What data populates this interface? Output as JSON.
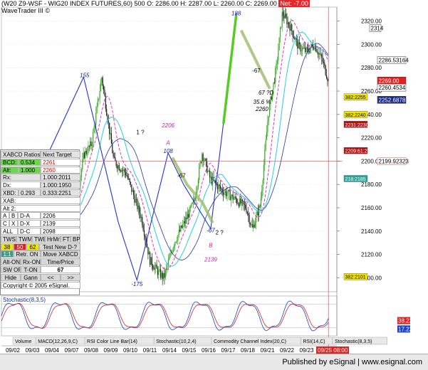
{
  "header": {
    "line1_prefix": "(W20 Z9-WSF - WIG20 INDEX FUTURES,60) 500",
    "o": "O: 2286.00",
    "h": "H: 2287.00",
    "l": "L: 2260.00",
    "c": "C: 2269.00",
    "net": "Net: -7.00",
    "line2": "WaveTrader III ©"
  },
  "colors": {
    "up_candle": "#33aa22",
    "down_candle": "#222222",
    "wave_line": "#2233cc",
    "green_channel": "#99bb66",
    "cyan_ma": "#22ccee",
    "blue_ma": "#2233aa",
    "magenta_ma": "#dd22aa",
    "stoch_blue": "#1144cc",
    "stoch_red": "#dd2222",
    "crosshair": "#e05050"
  },
  "chart_data": [
    {
      "type": "candlestick",
      "interval": "60 min",
      "yaxis_ticks": [
        2100,
        2120,
        2140,
        2160,
        2180,
        2200,
        2220,
        2240,
        2260,
        2280,
        2300,
        2320
      ],
      "ylim": [
        2088,
        2332
      ],
      "x_ticks": [
        "09/02",
        "09/03",
        "09/04",
        "09/07",
        "09/08",
        "09/09",
        "09/10",
        "09/11",
        "09/14",
        "09/15",
        "09/16",
        "09/17",
        "09/18",
        "09/21",
        "09/22",
        "09/23",
        "0"
      ],
      "current_time_label": "09/25 08:00",
      "price_labels": [
        {
          "text": "2314",
          "value": 2314,
          "style": "white"
        },
        {
          "text": "2286.53164",
          "value": 2286.5,
          "style": "white-magenta"
        },
        {
          "text": "2269.00",
          "value": 2269,
          "style": "red"
        },
        {
          "text": "2260.4534",
          "value": 2263,
          "style": "white-green"
        },
        {
          "text": "2252.6878",
          "value": 2252.5,
          "style": "navy"
        },
        {
          "text": "2199.92323",
          "value": 2199.9,
          "style": "red-line"
        }
      ],
      "level_boxes": [
        {
          "text": "382:2255",
          "value": 2255,
          "style": "yellow"
        },
        {
          "text": "382:2240",
          "value": 2240,
          "style": "yellow"
        },
        {
          "text": "2231:2230",
          "value": 2231.5,
          "style": "darkred"
        },
        {
          "text": "2209:61:2208",
          "value": 2209,
          "style": "darkred"
        },
        {
          "text": "218:2185",
          "value": 2185,
          "style": "teal"
        },
        {
          "text": "382:2101",
          "value": 2101,
          "style": "yellow"
        }
      ],
      "annotations": [
        {
          "text": "155",
          "x": 0.248,
          "value": 2272,
          "color": "#1122aa",
          "italic": true
        },
        {
          "text": "1 ?",
          "x": 0.414,
          "value": 2223,
          "color": "#000000",
          "italic": false
        },
        {
          "text": "2206",
          "x": 0.497,
          "value": 2229,
          "color": "#cc22aa",
          "italic": true
        },
        {
          "text": "A",
          "x": 0.497,
          "value": 2214,
          "color": "#cc22aa",
          "italic": true
        },
        {
          "text": "108",
          "x": 0.497,
          "value": 2207,
          "color": "#1122aa",
          "italic": true
        },
        {
          "text": "-67",
          "x": 0.537,
          "value": 2186,
          "color": "#000000",
          "italic": false
        },
        {
          "text": "-175",
          "x": 0.404,
          "value": 2093,
          "color": "#1122aa",
          "italic": true
        },
        {
          "text": "-67",
          "x": 0.624,
          "value": 2139,
          "color": "#1122aa",
          "italic": true
        },
        {
          "text": "2 ?",
          "x": 0.65,
          "value": 2137,
          "color": "#000000",
          "italic": false
        },
        {
          "text": "B",
          "x": 0.624,
          "value": 2126,
          "color": "#cc22aa",
          "italic": true
        },
        {
          "text": "2139",
          "x": 0.624,
          "value": 2114,
          "color": "#cc22aa",
          "italic": true
        },
        {
          "text": "188",
          "x": 0.7,
          "value": 2325,
          "color": "#1122aa",
          "italic": true
        },
        {
          "text": "-67",
          "x": 0.76,
          "value": 2276,
          "color": "#000000",
          "italic": false
        },
        {
          "text": "67 ?D",
          "x": 0.789,
          "value": 2257,
          "color": "#000000",
          "italic": true
        },
        {
          "text": "35.6 %",
          "x": 0.777,
          "value": 2249,
          "color": "#000000",
          "italic": true
        },
        {
          "text": "2260",
          "x": 0.777,
          "value": 2243,
          "color": "#000000",
          "italic": true
        }
      ]
    },
    {
      "type": "line",
      "title": "Stochastic(8,3,5)",
      "ylim": [
        0,
        100
      ],
      "reference_lines": [
        20,
        80
      ],
      "value_labels": [
        {
          "text": "38.22",
          "value": 38.22,
          "style": "red"
        },
        {
          "text": "17.22",
          "value": 17.22,
          "style": "blue"
        }
      ]
    }
  ],
  "tabs": [
    {
      "label": "Volume"
    },
    {
      "label": "MACD(12,26,9,C)"
    },
    {
      "label": "RSI Color Line Bar(14)"
    },
    {
      "label": "Stochastic(10,2,4)"
    },
    {
      "label": "Commodity Channel Index(20,C)"
    },
    {
      "label": "RSI(14,C)"
    },
    {
      "label": "Stochastic(8,3,5)"
    }
  ],
  "panel": {
    "rows": [
      {
        "cells": [
          {
            "text": "XABCD Ratios",
            "style": "grey",
            "w": 56
          },
          {
            "text": "Next Target",
            "style": "grey",
            "w": 56
          }
        ]
      },
      {
        "cells": [
          {
            "text": "BCD:",
            "style": "green",
            "w": 25
          },
          {
            "text": "0.534",
            "style": "green",
            "w": 31
          },
          {
            "text": "2261",
            "style": "white redtxt",
            "w": 56
          }
        ]
      },
      {
        "cells": [
          {
            "text": "Alt:",
            "style": "green",
            "w": 25
          },
          {
            "text": "1.000",
            "style": "green",
            "w": 31
          },
          {
            "text": "2260",
            "style": "white redtxt",
            "w": 56
          }
        ]
      },
      {
        "cells": [
          {
            "text": "Rx:",
            "style": "grey",
            "w": 56
          },
          {
            "text": "1.000:2011",
            "style": "grey",
            "w": 56
          }
        ]
      },
      {
        "cells": [
          {
            "text": "Dx:",
            "style": "white",
            "w": 56
          },
          {
            "text": "1.000:1950",
            "style": "grey",
            "w": 56
          }
        ]
      },
      {
        "cells": [
          {
            "text": "XBD:",
            "style": "grey",
            "w": 25
          },
          {
            "text": "0.293",
            "style": "grey",
            "w": 31
          },
          {
            "text": "0.333:2251",
            "style": "grey",
            "w": 56
          }
        ]
      },
      {
        "cells": [
          {
            "text": "XAB:",
            "style": "white",
            "w": 112
          }
        ]
      },
      {
        "cells": [
          {
            "text": "Alt 2:",
            "style": "white",
            "w": 112
          }
        ]
      },
      {
        "cells": [
          {
            "text": "A",
            "style": "white",
            "w": 12
          },
          {
            "text": "B",
            "style": "white",
            "w": 12
          },
          {
            "text": "D-A",
            "style": "white",
            "w": 32
          },
          {
            "text": "2206",
            "style": "white",
            "w": 56
          }
        ]
      },
      {
        "cells": [
          {
            "text": "C",
            "style": "white",
            "w": 12
          },
          {
            "text": "X",
            "style": "white",
            "w": 12
          },
          {
            "text": "D-X",
            "style": "white",
            "w": 32
          },
          {
            "text": "2139",
            "style": "white",
            "w": 56
          }
        ]
      },
      {
        "cells": [
          {
            "text": "ALL",
            "style": "white",
            "w": 24
          },
          {
            "text": "D-C",
            "style": "white",
            "w": 32
          },
          {
            "text": "2098",
            "style": "white",
            "w": 56
          }
        ]
      },
      {
        "cells": [
          {
            "text": "TWS",
            "style": "btn",
            "w": 22
          },
          {
            "text": "TWM",
            "style": "btn",
            "w": 22
          },
          {
            "text": "TWF",
            "style": "btn",
            "w": 18
          },
          {
            "text": "HrMn",
            "style": "btn",
            "w": 22
          },
          {
            "text": "FTP",
            "style": "btn",
            "w": 14
          },
          {
            "text": "BPL",
            "style": "btn",
            "w": 14
          }
        ]
      },
      {
        "cells": [
          {
            "text": "38",
            "style": "yellow",
            "w": 18
          },
          {
            "text": "50",
            "style": "red",
            "w": 18
          },
          {
            "text": "62",
            "style": "yellow",
            "w": 18
          },
          {
            "text": "Test New D-?",
            "style": "btn",
            "w": 58
          }
        ]
      },
      {
        "cells": [
          {
            "text": "1:1",
            "style": "teal",
            "w": 18
          },
          {
            "text": "Retr. ON",
            "style": "btn",
            "w": 38
          },
          {
            "text": "Move XABCD",
            "style": "btn",
            "w": 56
          }
        ]
      },
      {
        "cells": [
          {
            "text": "Alt-ON",
            "style": "btn",
            "w": 28
          },
          {
            "text": "Rx-ON",
            "style": "btn",
            "w": 28
          },
          {
            "text": "Time/Price",
            "style": "btn",
            "w": 56
          }
        ]
      },
      {
        "cells": [
          {
            "text": "SW OFF",
            "style": "btn",
            "w": 28
          },
          {
            "text": "T-ON",
            "style": "btn",
            "w": 28
          },
          {
            "text": "67",
            "style": "white",
            "w": 56,
            "bold": true
          }
        ]
      },
      {
        "cells": [
          {
            "text": "Hide",
            "style": "btn",
            "w": 28
          },
          {
            "text": "Gann",
            "style": "btn",
            "w": 28
          },
          {
            "text": "<<",
            "style": "btn",
            "w": 28
          },
          {
            "text": ">>",
            "style": "btn",
            "w": 28
          }
        ]
      },
      {
        "cells": [
          {
            "text": "Copyright © 2005 eSignal.",
            "style": "white",
            "w": 112
          }
        ]
      }
    ]
  },
  "footer": {
    "text": "Published by eSignal | www.esignal.com"
  }
}
